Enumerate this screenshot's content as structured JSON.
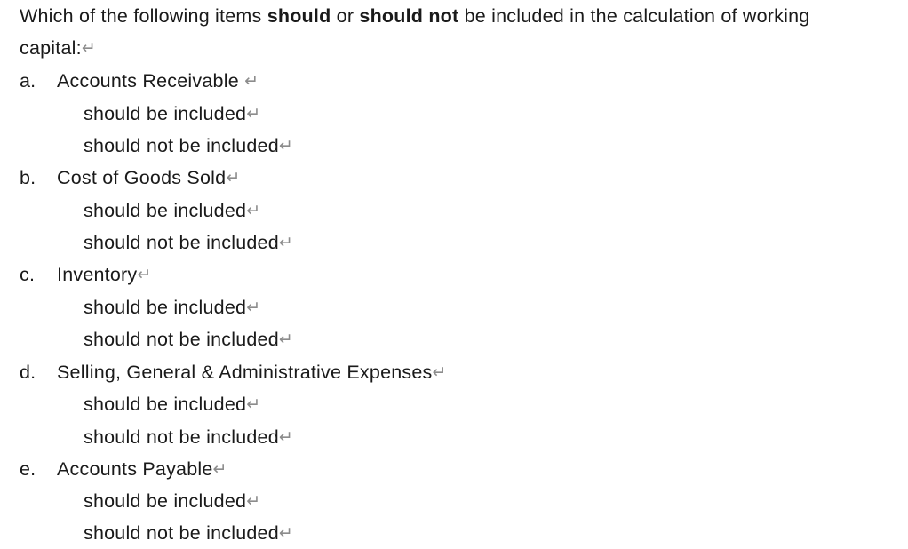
{
  "document": {
    "background_color": "#ffffff",
    "text_color": "#1a1a1a",
    "paragraph_mark_color": "#8c8c8c",
    "paragraph_mark_glyph": "↵",
    "stem": {
      "line1_part1": "Which of the following items ",
      "line1_bold1": "should",
      "line1_part2": " or ",
      "line1_bold2": "should not",
      "line1_part3": " be included in the calculation of working",
      "line2": "capital:"
    },
    "option_labels": {
      "included": "should be included",
      "not_included": "should not be included"
    },
    "items": [
      {
        "marker": "a.",
        "text": "Accounts Receivable ",
        "options": [
          "should be included",
          "should not be included"
        ]
      },
      {
        "marker": "b.",
        "text": "Cost of Goods Sold",
        "options": [
          "should be included",
          "should not be included"
        ]
      },
      {
        "marker": "c.",
        "text": "Inventory",
        "options": [
          "should be included",
          "should not be included"
        ]
      },
      {
        "marker": "d.",
        "text": "Selling, General & Administrative Expenses",
        "options": [
          "should be included",
          "should not be included"
        ]
      },
      {
        "marker": "e.",
        "text": "Accounts Payable",
        "options": [
          "should be included",
          "should not be included"
        ]
      }
    ]
  }
}
